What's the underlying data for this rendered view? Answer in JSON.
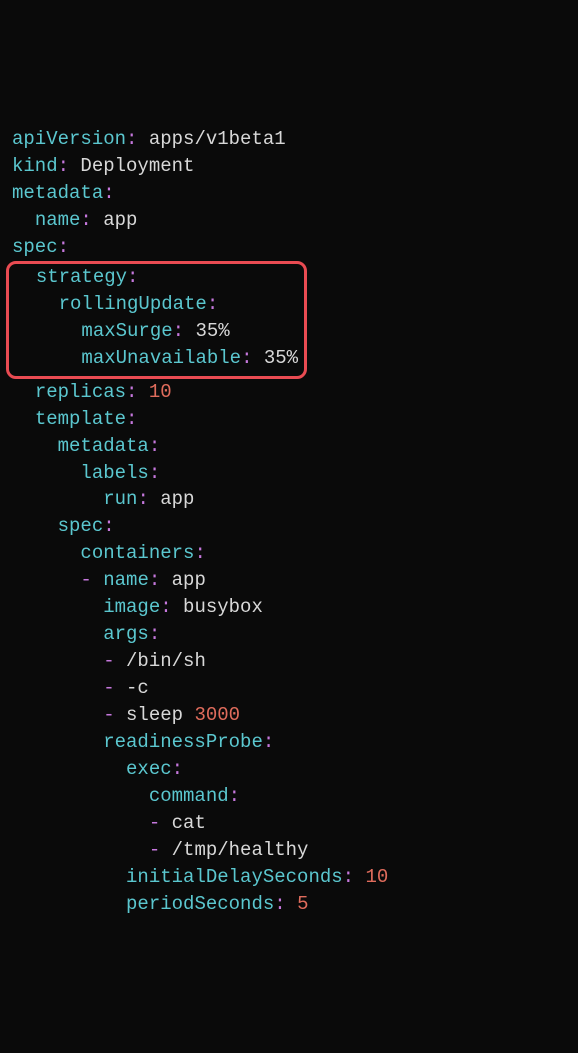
{
  "yaml": {
    "apiVersion": {
      "k": "apiVersion",
      "v": "apps/v1beta1"
    },
    "kind": {
      "k": "kind",
      "v": "Deployment"
    },
    "metadata": {
      "k": "metadata"
    },
    "metadata_name": {
      "k": "name",
      "v": "app"
    },
    "spec": {
      "k": "spec"
    },
    "strategy": {
      "k": "strategy"
    },
    "rollingUpdate": {
      "k": "rollingUpdate"
    },
    "maxSurge": {
      "k": "maxSurge",
      "v": "35%"
    },
    "maxUnavailable": {
      "k": "maxUnavailable",
      "v": "35%"
    },
    "replicas": {
      "k": "replicas",
      "v": "10"
    },
    "template": {
      "k": "template"
    },
    "template_metadata": {
      "k": "metadata"
    },
    "labels": {
      "k": "labels"
    },
    "run": {
      "k": "run",
      "v": "app"
    },
    "template_spec": {
      "k": "spec"
    },
    "containers": {
      "k": "containers"
    },
    "container_name": {
      "k": "name",
      "v": "app"
    },
    "image": {
      "k": "image",
      "v": "busybox"
    },
    "args": {
      "k": "args"
    },
    "arg0": "/bin/sh",
    "arg1": "-c",
    "arg2a": "sleep ",
    "arg2b": "3000",
    "readinessProbe": {
      "k": "readinessProbe"
    },
    "exec": {
      "k": "exec"
    },
    "command": {
      "k": "command"
    },
    "cmd0": "cat",
    "cmd1": "/tmp/healthy",
    "initialDelaySeconds": {
      "k": "initialDelaySeconds",
      "v": "10"
    },
    "periodSeconds": {
      "k": "periodSeconds",
      "v": "5"
    },
    "colon": ":",
    "dash": "-"
  }
}
